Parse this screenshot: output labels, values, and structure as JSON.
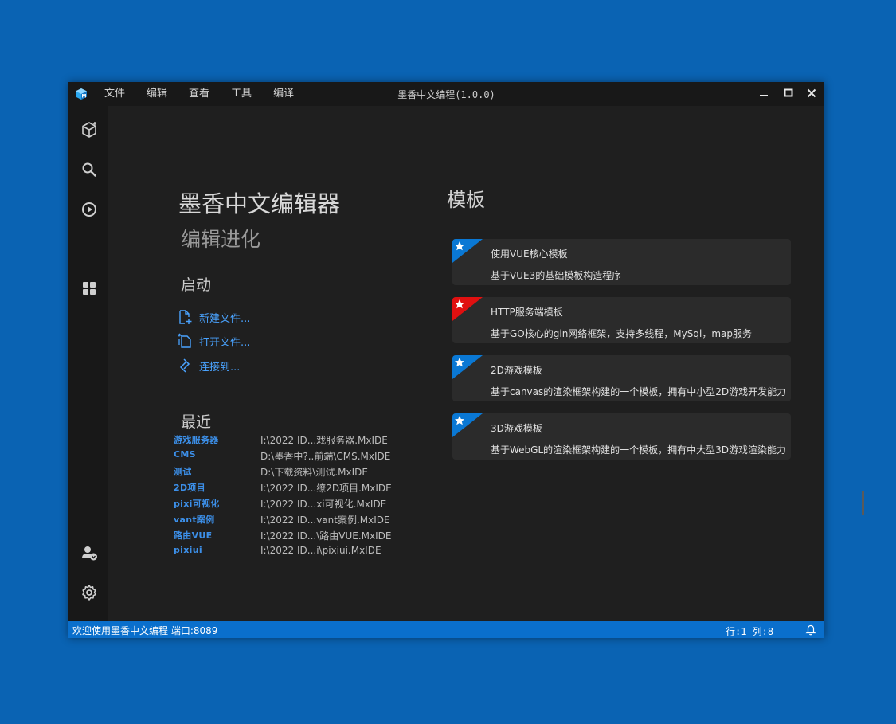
{
  "titlebar": {
    "title": "墨香中文编程(1.0.0)",
    "menu": [
      "文件",
      "编辑",
      "查看",
      "工具",
      "编译"
    ],
    "logo_icon": "cube-logo-icon"
  },
  "activity_bar": {
    "top_icons": [
      "cube-icon",
      "search-icon",
      "run-debug-icon",
      "extensions-icon"
    ],
    "bottom_icons": [
      "account-icon",
      "gear-icon"
    ]
  },
  "welcome": {
    "title": "墨香中文编辑器",
    "subtitle": "编辑进化",
    "start": {
      "heading": "启动",
      "items": [
        {
          "label": "新建文件...",
          "icon": "new-file-icon"
        },
        {
          "label": "打开文件...",
          "icon": "open-file-icon"
        },
        {
          "label": "连接到...",
          "icon": "remote-connect-icon"
        }
      ]
    },
    "recent": {
      "heading": "最近",
      "items": [
        {
          "name": "游戏服务器",
          "path": "I:\\2022  ID...戏服务器.MxIDE"
        },
        {
          "name": "CMS",
          "path": "D:\\墨香中?..前端\\CMS.MxIDE"
        },
        {
          "name": "测试",
          "path": "D:\\下载资料\\测试.MxIDE"
        },
        {
          "name": "2D项目",
          "path": "I:\\2022  ID...缭2D项目.MxIDE"
        },
        {
          "name": "pixi可视化",
          "path": "I:\\2022  ID...xi可视化.MxIDE"
        },
        {
          "name": "vant案例",
          "path": "I:\\2022  ID...vant案例.MxIDE"
        },
        {
          "name": "路由VUE",
          "path": "I:\\2022  ID...\\路由VUE.MxIDE"
        },
        {
          "name": "pixiui",
          "path": "I:\\2022  ID...i\\pixiui.MxIDE"
        }
      ]
    }
  },
  "templates": {
    "heading": "模板",
    "items": [
      {
        "name": "使用VUE核心模板",
        "desc": "基于VUE3的基础模板构造程序",
        "badge_color": "#0a78d4"
      },
      {
        "name": "HTTP服务端模板",
        "desc": "基于GO核心的gin网络框架，支持多线程，MySql，map服务",
        "badge_color": "#e01010"
      },
      {
        "name": "2D游戏模板",
        "desc": "基于canvas的渲染框架构建的一个模板，拥有中小型2D游戏开发能力",
        "badge_color": "#0a78d4"
      },
      {
        "name": "3D游戏模板",
        "desc": "基于WebGL的渲染框架构建的一个模板，拥有中大型3D游戏渲染能力",
        "badge_color": "#0a78d4"
      }
    ]
  },
  "statusbar": {
    "message": "欢迎使用墨香中文编程 端口:8089",
    "position": "行:1 列:8",
    "bell_icon": "bell-icon"
  }
}
